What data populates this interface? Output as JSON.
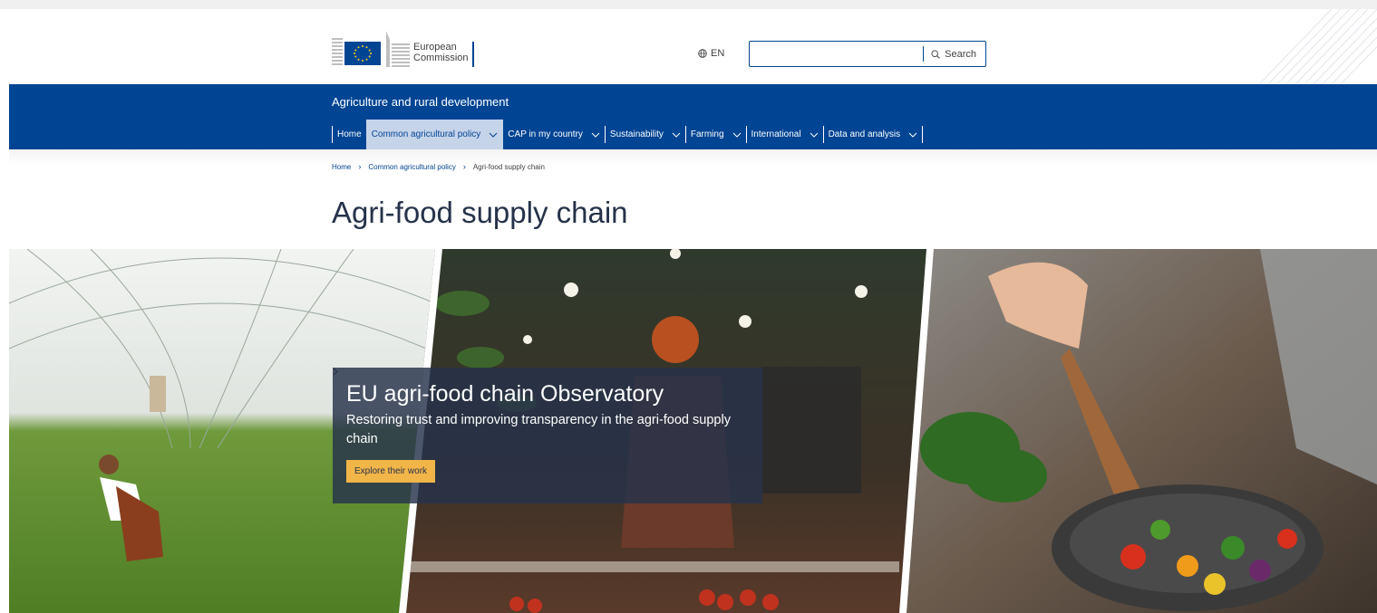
{
  "header": {
    "logo": {
      "line1": "European",
      "line2": "Commission",
      "flag_color": "#004494",
      "star_color": "#ffd617"
    },
    "language": {
      "code": "EN",
      "icon": "globe-icon"
    },
    "search": {
      "placeholder": "",
      "button_label": "Search",
      "icon": "search-icon"
    }
  },
  "site": {
    "name": "Agriculture and rural development",
    "bar_color": "#004494"
  },
  "nav": {
    "items": [
      {
        "label": "Home",
        "has_dropdown": false,
        "active": false
      },
      {
        "label": "Common agricultural policy",
        "has_dropdown": true,
        "active": true
      },
      {
        "label": "CAP in my country",
        "has_dropdown": true,
        "active": false
      },
      {
        "label": "Sustainability",
        "has_dropdown": true,
        "active": false
      },
      {
        "label": "Farming",
        "has_dropdown": true,
        "active": false
      },
      {
        "label": "International",
        "has_dropdown": true,
        "active": false
      },
      {
        "label": "Data and analysis",
        "has_dropdown": true,
        "active": false
      }
    ]
  },
  "breadcrumb": {
    "items": [
      "Home",
      "Common agricultural policy"
    ],
    "current": "Agri-food supply chain"
  },
  "page": {
    "title": "Agri-food supply chain"
  },
  "hero": {
    "banner_title": "EU agri-food chain Observatory",
    "banner_subtitle": "Restoring trust and improving transparency in the agri-food supply chain",
    "button_label": "Explore their work",
    "button_color": "#f2b548",
    "banner_color": "#26324b"
  }
}
